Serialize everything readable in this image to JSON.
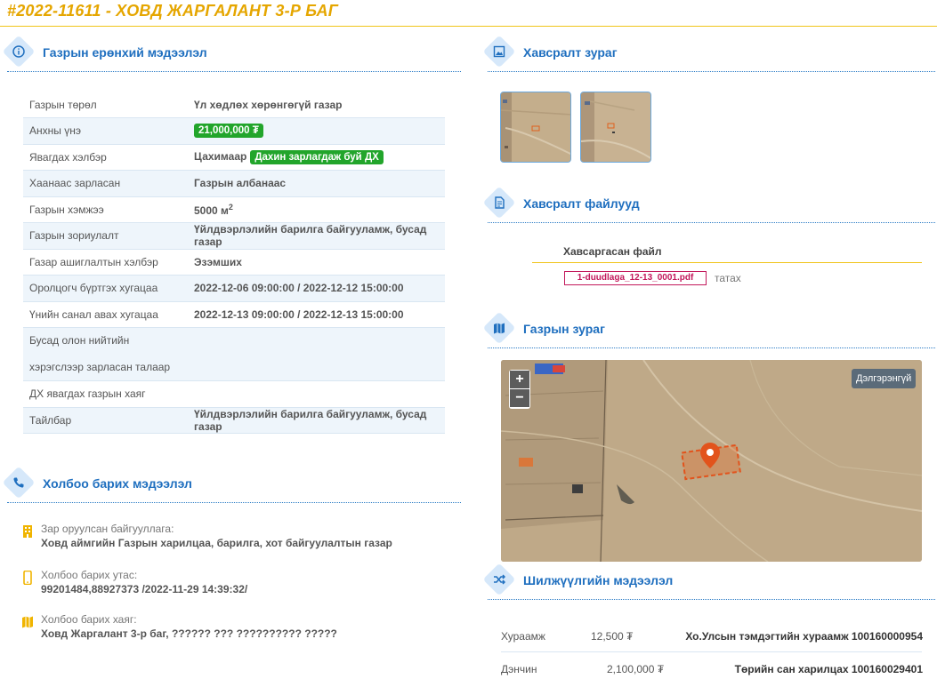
{
  "header": {
    "code": "#2022-11611",
    "separator": " - ",
    "name": "ХОВД ЖАРГАЛАНТ 3-Р БАГ"
  },
  "sections": {
    "general": "Газрын ерөнхий мэдээлэл",
    "contact": "Холбоо барих мэдээлэл",
    "attach_images": "Хавсралт зураг",
    "attach_files": "Хавсралт файлууд",
    "map": "Газрын зураг",
    "transfer": "Шилжүүлгийн мэдээлэл"
  },
  "info_rows": [
    {
      "k": "Газрын төрөл",
      "v": "Үл хөдлөх хөрөнгөгүй газар"
    },
    {
      "k": "Анхны үнэ",
      "badge": "21,000,000 ₮"
    },
    {
      "k": "Явагдах хэлбэр",
      "v": "Цахимаар",
      "badge": "Дахин зарлагдаж буй ДХ"
    },
    {
      "k": "Хаанаас зарласан",
      "v": "Газрын албанаас"
    },
    {
      "k": "Газрын хэмжээ",
      "v": "5000 м",
      "sup": "2"
    },
    {
      "k": "Газрын зориулалт",
      "v": "Үйлдвэрлэлийн барилга байгууламж, бусад газар"
    },
    {
      "k": "Газар ашиглалтын хэлбэр",
      "v": "Эзэмших"
    },
    {
      "k": "Оролцогч бүртгэх хугацаа",
      "v": "2022-12-06 09:00:00 / 2022-12-12 15:00:00"
    },
    {
      "k": "Үнийн санал авах хугацаа",
      "v": "2022-12-13 09:00:00 / 2022-12-13 15:00:00"
    },
    {
      "k": "Бусад олон нийтийн хэрэгслээр зарласан талаар",
      "v": ""
    },
    {
      "k": "ДХ явагдах газрын хаяг",
      "v": ""
    },
    {
      "k": "Тайлбар",
      "v": "Үйлдвэрлэлийн барилга байгууламж, бусад газар"
    }
  ],
  "contact": {
    "org_label": "Зар оруулсан байгууллага:",
    "org_value": "Ховд аймгийн Газрын харилцаа, барилга, хот байгуулалтын газар",
    "phone_label": "Холбоо барих утас:",
    "phone_value": "99201484,88927373 /2022-11-29 14:39:32/",
    "address_label": "Холбоо барих хаяг:",
    "address_value": "Ховд Жаргалант 3-р баг, ?????? ??? ?????????? ?????"
  },
  "files": {
    "col_header": "Хавсаргасан файл",
    "file_name": "1-duudlaga_12-13_0001.pdf",
    "download": "татах"
  },
  "map": {
    "zoom_in": "+",
    "zoom_out": "−",
    "more": "Дэлгэрэнгүй"
  },
  "transfer": [
    {
      "label": "Хураамж",
      "amount": "12,500 ₮",
      "account": "Хо.Улсын тэмдэгтийн хураамж 100160000954"
    },
    {
      "label": "Дэнчин",
      "amount": "2,100,000 ₮",
      "account": "Төрийн сан харилцах 100160029401"
    }
  ],
  "colors": {
    "accent": "#e5a600",
    "heading_blue": "#1f6fbf",
    "badge_green": "#22a52b",
    "file_red": "#c2185b"
  }
}
